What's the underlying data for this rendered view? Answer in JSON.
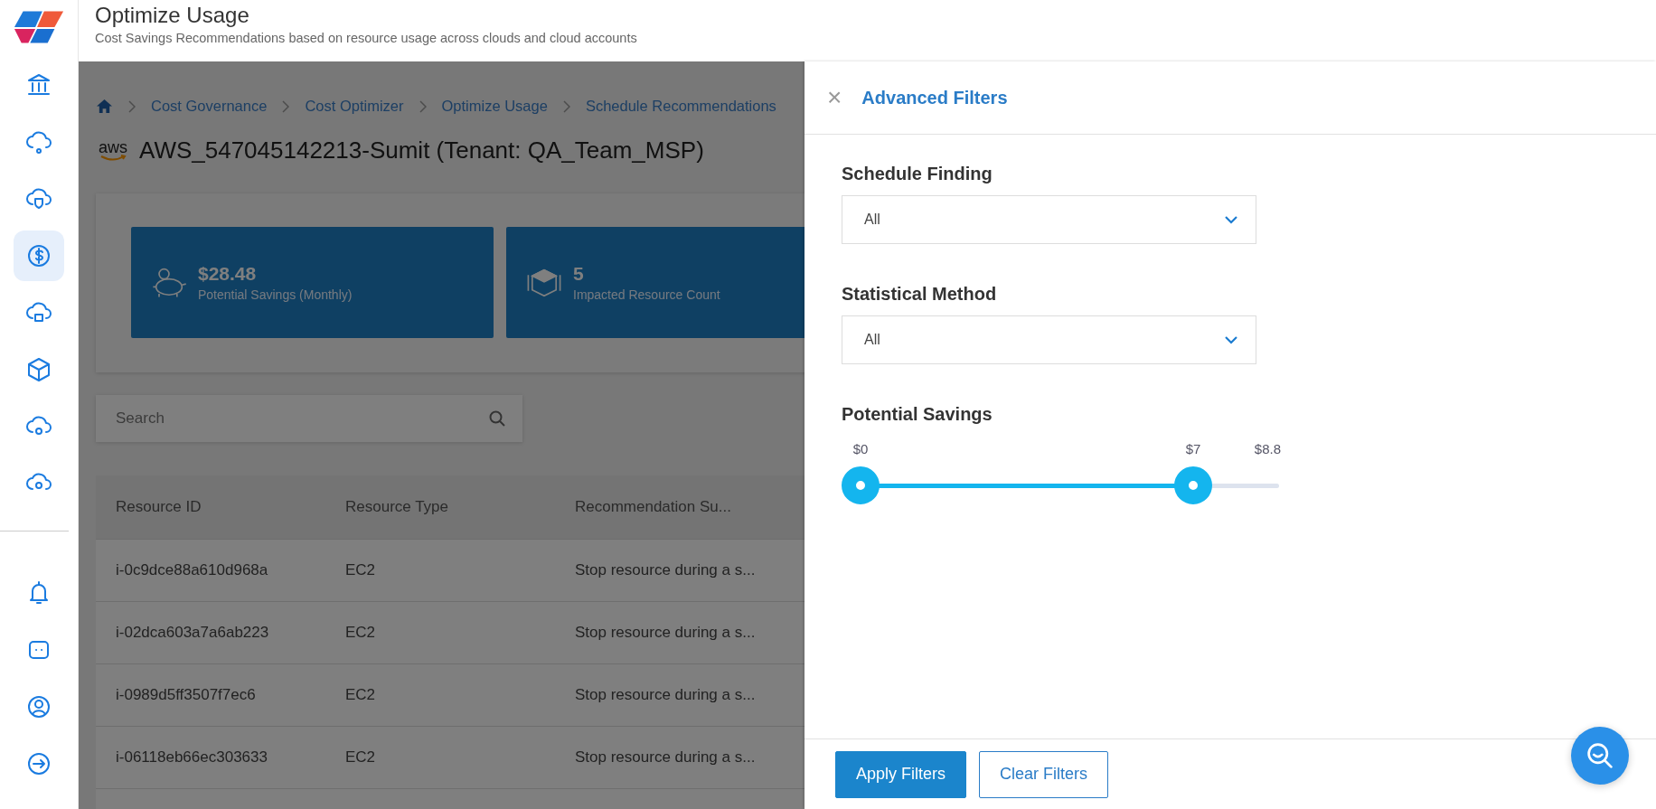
{
  "header": {
    "title": "Optimize Usage",
    "subtitle": "Cost Savings Recommendations based on resource usage across clouds and cloud accounts"
  },
  "sidebar": {
    "items": [
      {
        "selected": false
      },
      {
        "selected": false
      },
      {
        "selected": false
      },
      {
        "selected": true
      },
      {
        "selected": false
      },
      {
        "selected": false
      },
      {
        "selected": false
      },
      {
        "selected": false
      }
    ],
    "bottom_items": [
      {
        "selected": false
      },
      {
        "selected": false
      },
      {
        "selected": false
      },
      {
        "selected": false
      }
    ]
  },
  "breadcrumb": [
    "Cost Governance",
    "Cost Optimizer",
    "Optimize Usage",
    "Schedule Recommendations"
  ],
  "account": {
    "logo_text": "aws",
    "title": "AWS_547045142213-Sumit (Tenant: QA_Team_MSP)"
  },
  "summary_cards": [
    {
      "value": "$28.48",
      "label": "Potential Savings (Monthly)"
    },
    {
      "value": "5",
      "label": "Impacted Resource Count"
    }
  ],
  "search": {
    "placeholder": "Search"
  },
  "table": {
    "columns": [
      "Resource ID",
      "Resource Type",
      "Recommendation Su..."
    ],
    "rows": [
      [
        "i-0c9dce88a610d968a",
        "EC2",
        "Stop resource during a s..."
      ],
      [
        "i-02dca603a7a6ab223",
        "EC2",
        "Stop resource during a s..."
      ],
      [
        "i-0989d5ff3507f7ec6",
        "EC2",
        "Stop resource during a s..."
      ],
      [
        "i-06118eb66ec303633",
        "EC2",
        "Stop resource during a s..."
      ]
    ]
  },
  "filters_panel": {
    "close": "×",
    "title": "Advanced Filters",
    "fields": [
      {
        "label": "Schedule Finding",
        "value": "All"
      },
      {
        "label": "Statistical Method",
        "value": "All"
      }
    ],
    "savings": {
      "label": "Potential Savings",
      "thumbs": [
        {
          "label": "$0",
          "level": 0
        },
        {
          "label": "$7",
          "level": 0.795
        }
      ],
      "max_label": "$8.8"
    },
    "buttons": [
      {
        "label": "Apply Filters",
        "kind": "primary"
      },
      {
        "label": "Clear Filters",
        "kind": "secondary"
      }
    ]
  }
}
